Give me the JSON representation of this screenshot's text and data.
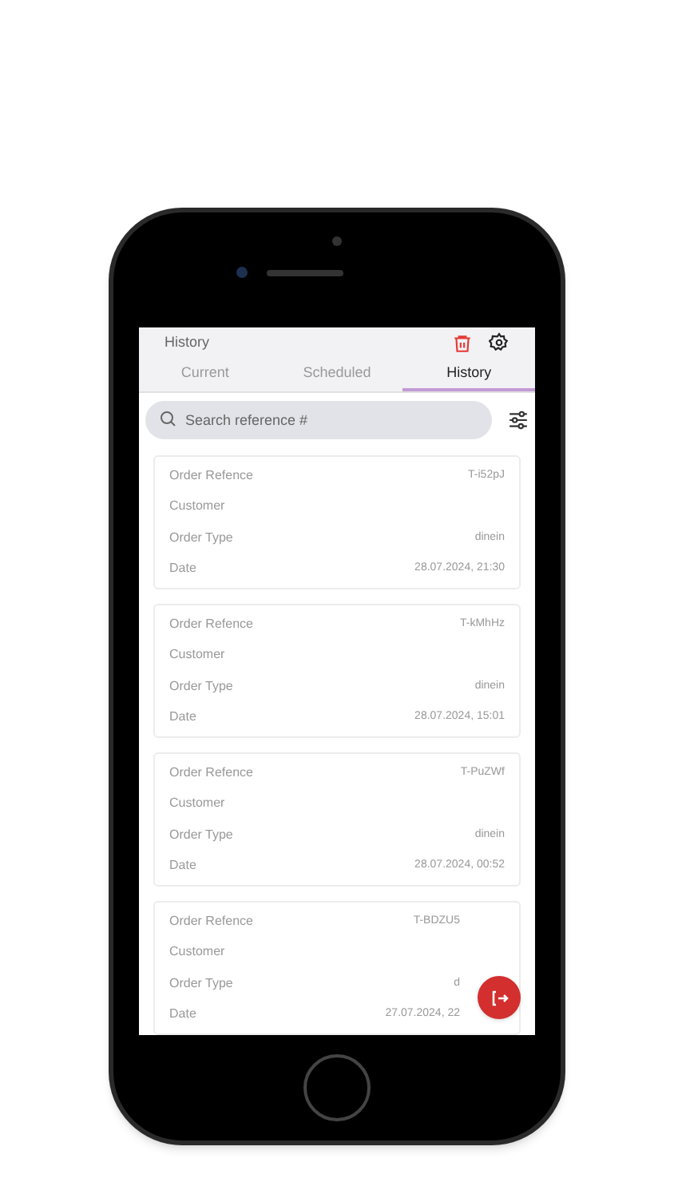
{
  "header": {
    "title": "History"
  },
  "tabs": [
    {
      "label": "Current",
      "selected": false
    },
    {
      "label": "Scheduled",
      "selected": false
    },
    {
      "label": "History",
      "selected": true
    }
  ],
  "search": {
    "placeholder": "Search reference #"
  },
  "orders": [
    {
      "covered": false,
      "rows": [
        {
          "label": "Order Refence",
          "value": "T-i52pJ"
        },
        {
          "label": "Customer"
        },
        {
          "label": "Order Type",
          "value": "dinein"
        },
        {
          "label": "Date",
          "value": "28.07.2024, 21:30"
        }
      ]
    },
    {
      "covered": false,
      "rows": [
        {
          "label": "Order Refence",
          "value": "T-kMhHz"
        },
        {
          "label": "Customer"
        },
        {
          "label": "Order Type",
          "value": "dinein"
        },
        {
          "label": "Date",
          "value": "28.07.2024, 15:01"
        }
      ]
    },
    {
      "covered": false,
      "rows": [
        {
          "label": "Order Refence",
          "value": "T-PuZWf"
        },
        {
          "label": "Customer"
        },
        {
          "label": "Order Type",
          "value": "dinein"
        },
        {
          "label": "Date",
          "value": "28.07.2024, 00:52"
        }
      ]
    },
    {
      "covered": true,
      "rows": [
        {
          "label": "Order Refence",
          "value": "T-BDZU5"
        },
        {
          "label": "Customer"
        },
        {
          "label": "Order Type",
          "value": "d"
        },
        {
          "label": "Date",
          "value": "27.07.2024, 22"
        }
      ]
    }
  ]
}
